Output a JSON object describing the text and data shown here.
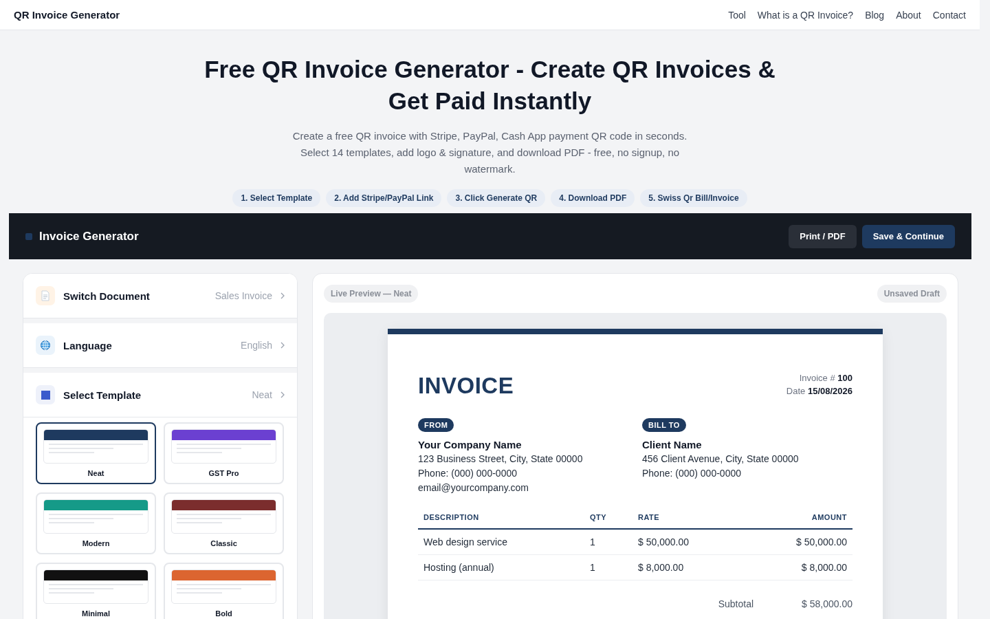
{
  "nav": {
    "brand": "QR Invoice Generator",
    "links": [
      "Tool",
      "What is a QR Invoice?",
      "Blog",
      "About",
      "Contact"
    ]
  },
  "hero": {
    "title": "Free QR Invoice Generator - Create QR Invoices & Get Paid Instantly",
    "subtitle": "Create a free QR invoice with Stripe, PayPal, Cash App payment QR code in seconds. Select 14 templates, add logo & signature, and download PDF - free, no signup, no watermark.",
    "steps": [
      "1. Select Template",
      "2. Add Stripe/PayPal Link",
      "3. Click Generate QR",
      "4. Download PDF",
      "5. Swiss Qr Bill/Invoice"
    ]
  },
  "toolbar": {
    "title": "Invoice Generator",
    "buttons": [
      {
        "label": "Print / PDF",
        "kind": "secondary"
      },
      {
        "label": "Save & Continue",
        "kind": "primary"
      }
    ]
  },
  "settings": [
    {
      "kind": "document",
      "label": "Switch Document",
      "value": "Sales Invoice"
    },
    {
      "kind": "language",
      "label": "Language",
      "value": "English"
    },
    {
      "kind": "template",
      "label": "Select Template",
      "value": "Neat"
    }
  ],
  "templates": [
    {
      "name": "Neat",
      "color": "#1e3a5f",
      "selected": true
    },
    {
      "name": "GST Pro",
      "color": "#6b40d1",
      "selected": false
    },
    {
      "name": "Modern",
      "color": "#159a88",
      "selected": false
    },
    {
      "name": "Classic",
      "color": "#7b2d2d",
      "selected": false
    },
    {
      "name": "Minimal",
      "color": "#111111",
      "selected": false
    },
    {
      "name": "Bold",
      "color": "#dc6530",
      "selected": false
    }
  ],
  "preview": {
    "label": "Live Preview — Neat",
    "status": "Unsaved Draft",
    "invoice": {
      "title": "INVOICE",
      "number_label": "Invoice #",
      "number": "100",
      "date_label": "Date",
      "date": "15/08/2026",
      "from": {
        "tag": "FROM",
        "name": "Your Company Name",
        "lines": [
          "123 Business Street, City, State 00000",
          "Phone: (000) 000-0000",
          "email@yourcompany.com"
        ]
      },
      "bill_to": {
        "tag": "BILL TO",
        "name": "Client Name",
        "lines": [
          "456 Client Avenue, City, State 00000",
          "Phone: (000) 000-0000"
        ]
      },
      "columns": [
        "DESCRIPTION",
        "QTY",
        "RATE",
        "AMOUNT"
      ],
      "rows": [
        [
          "Web design service",
          "1",
          "$ 50,000.00",
          "$ 50,000.00"
        ],
        [
          "Hosting (annual)",
          "1",
          "$ 8,000.00",
          "$ 8,000.00"
        ]
      ],
      "subtotal_label": "Subtotal",
      "subtotal": "$ 58,000.00"
    }
  }
}
